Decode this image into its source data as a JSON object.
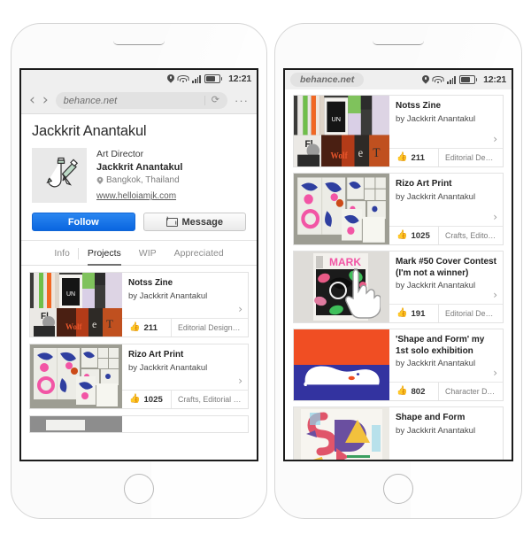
{
  "status_bar": {
    "time": "12:21",
    "icons": [
      "location-pin-icon",
      "wifi-icon",
      "signal-bars-icon",
      "battery-icon"
    ]
  },
  "browser": {
    "back_label": "‹",
    "forward_label": "›",
    "url": "behance.net",
    "reload_label": "⟳",
    "menu_label": "···"
  },
  "profile": {
    "name": "Jackkrit Anantakul",
    "role": "Art Director",
    "display_name": "Jackkrit Anantakul",
    "location": "Bangkok, Thailand",
    "website": "www.helloiamjk.com",
    "avatar_alt": "JK pencil monogram",
    "follow_label": "Follow",
    "message_label": "Message"
  },
  "tabs": [
    {
      "label": "Info",
      "active": false
    },
    {
      "label": "Projects",
      "active": true
    },
    {
      "label": "WIP",
      "active": false
    },
    {
      "label": "Appreciated",
      "active": false
    }
  ],
  "left_projects": [
    {
      "title": "Notss Zine",
      "by": "by Jackkrit Anantakul",
      "likes": "211",
      "tags": "Editorial Design, Gr..",
      "arrow": "›",
      "thumb": "zine"
    },
    {
      "title": "Rizo Art Print",
      "by": "by Jackkrit Anantakul",
      "likes": "1025",
      "tags": "Crafts, Editorial Des..",
      "arrow": "›",
      "thumb": "rizo"
    }
  ],
  "right_projects": [
    {
      "title": "Notss Zine",
      "by": "by  Jackkrit Anantakul",
      "likes": "211",
      "tags": "Editorial Design, Gr..",
      "arrow": "›",
      "thumb": "zine"
    },
    {
      "title": "Rizo Art Print",
      "by": "by  Jackkrit Anantakul",
      "likes": "1025",
      "tags": "Crafts, Editorial Des..",
      "arrow": "›",
      "thumb": "rizo"
    },
    {
      "title": "Mark #50 Cover Contest (I'm not a winner)",
      "by": "by  Jackkrit Anantakul",
      "likes": "191",
      "tags": "Editorial Design, Gr..",
      "arrow": "›",
      "thumb": "mark"
    },
    {
      "title": "'Shape and Form' my 1st solo exhibition",
      "by": "by  Jackkrit Anantakul",
      "likes": "802",
      "tags": "Character Design, G..",
      "arrow": "›",
      "thumb": "solo"
    },
    {
      "title": "Shape and Form",
      "by": "by  Jackkrit Anantakul",
      "likes": "",
      "tags": "",
      "arrow": "›",
      "thumb": "shape"
    }
  ],
  "colors": {
    "follow_blue": "#1574ec",
    "solo_orange": "#f04e23",
    "solo_blue": "#3333a0",
    "accent_gray": "#7c7c7c"
  },
  "cursor": {
    "name": "pointing-hand-cursor"
  }
}
